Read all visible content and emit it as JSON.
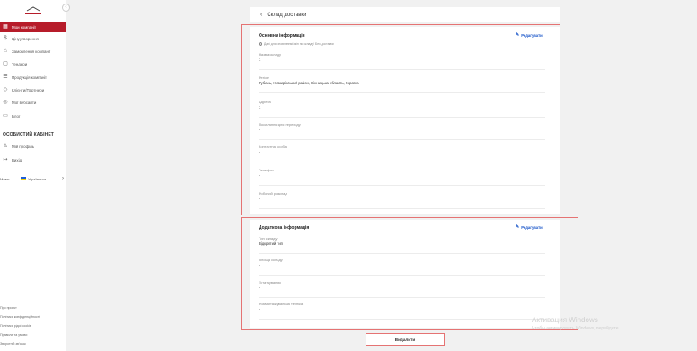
{
  "sidebar": {
    "logo_text": "",
    "collapse_icon": "chevron-left-icon",
    "items": [
      {
        "label": "Мои компанії",
        "icon": "building-icon",
        "active": true
      },
      {
        "label": "Цінуутворення",
        "icon": "dollar-icon",
        "active": false
      },
      {
        "label": "Замовлення компанії",
        "icon": "cart-icon",
        "active": false
      },
      {
        "label": "Тендери",
        "icon": "tender-icon",
        "active": false
      },
      {
        "label": "Продукція компанії",
        "icon": "list-icon",
        "active": false
      },
      {
        "label": "Клієнти/Партнери",
        "icon": "handshake-icon",
        "active": false
      },
      {
        "label": "Мої вебсайти",
        "icon": "globe-icon",
        "active": false
      },
      {
        "label": "Блог",
        "icon": "blog-icon",
        "active": false
      }
    ],
    "section_title": "ОСОБИСТИЙ КАБІНЕТ",
    "personal": [
      {
        "label": "Мій профіль",
        "icon": "user-icon"
      },
      {
        "label": "Вихід",
        "icon": "logout-icon"
      }
    ],
    "lang": {
      "label": "Мова:",
      "value": "Українська"
    },
    "footer": [
      "Про проект",
      "Політика конфіденційності",
      "Політика рідоі cookie",
      "Правила та умови",
      "Зворотній зв'язок"
    ]
  },
  "header": {
    "back_icon": "chevron-left-icon",
    "title": "Склад доставки"
  },
  "main_card": {
    "title": "Основна інформація",
    "edit_label": "Редагувати",
    "hint": "Дані для оновлення/змін по складу/ Без доставки",
    "fields": [
      {
        "label": "Назва складу",
        "value": "1"
      },
      {
        "label": "Регіон",
        "value": "Рубань, Немирівський район, Вінницька область, Україна"
      },
      {
        "label": "Адреса",
        "value": "1"
      },
      {
        "label": "Посилання для переходу",
        "value": "-"
      },
      {
        "label": "Контактна особа",
        "value": "-"
      },
      {
        "label": "Телефон",
        "value": "-"
      },
      {
        "label": "Робочий розклад",
        "value": "-"
      }
    ]
  },
  "extra_card": {
    "title": "Додаткова інформація",
    "edit_label": "Редагувати",
    "fields": [
      {
        "label": "Тип складу",
        "value": "Відкритий тип"
      },
      {
        "label": "Площа складу",
        "value": "-"
      },
      {
        "label": "Устаткування",
        "value": "-"
      },
      {
        "label": "Розвантажувальна техніка",
        "value": "-"
      }
    ]
  },
  "delete_label": "Видалити",
  "watermark": {
    "line1": "Активация Windows",
    "line2": "Чтобы активировать Windows, перейдите"
  },
  "colors": {
    "accent": "#b71c2a",
    "link": "#1a56c9",
    "outline": "#e57373"
  }
}
